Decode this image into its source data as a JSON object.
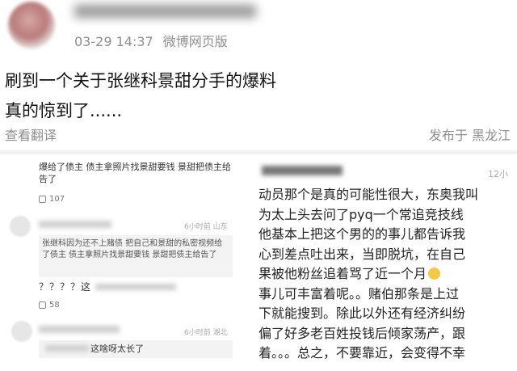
{
  "post": {
    "timestamp": "03-29 14:37",
    "source": "微博网页版",
    "lines": [
      "刷到一个关于张继科景甜分手的爆料",
      "真的惊到了......"
    ],
    "translate_label": "查看翻译",
    "location": "发布于 黑龙江"
  },
  "left_screenshot": {
    "comment1": {
      "text": "爆给了债主 债主拿照片找景甜要钱 景甜把债主给告了",
      "likes": "107"
    },
    "comment2": {
      "meta": "6小时前 山东",
      "quote": "张继科因为还不上赌债 把自己和景甜的私密视频给了债主 债主拿照片找景甜要钱 景甜把债主给告了",
      "reply": "？？？？这",
      "likes": "58"
    },
    "comment3": {
      "meta": "6小时前 湖北",
      "reply": "这啥呀太长了"
    }
  },
  "right_screenshot": {
    "time": "12小",
    "lines": [
      "动员那个是真的可能性很大，东奥我叫",
      "为太上头去问了pyq一个常追竞技线",
      "他基本上把这个男的的事儿都告诉我",
      "心到差点吐出来，当即脱坑，在自己",
      "果被他粉丝追着骂了近一个月",
      "事儿可丰富着呢。。赌伯那条是上过",
      "下就能搜到。除此以外还有经济纠纷",
      "偏了好多老百姓投钱后倾家荡产，跟",
      "着。。。总之，不要靠近，会变得不幸"
    ]
  }
}
